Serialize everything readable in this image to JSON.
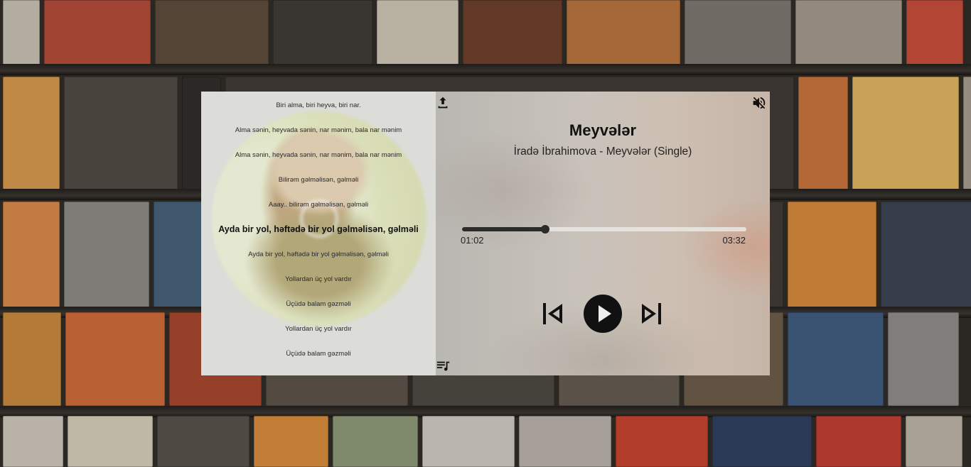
{
  "track": {
    "title": "Meyvələr",
    "subtitle": "İradə İbrahimova - Meyvələr (Single)"
  },
  "progress": {
    "current": "01:02",
    "duration": "03:32",
    "fraction": 0.292
  },
  "lyrics": [
    {
      "text": "Biri alma, biri heyva, biri nar.",
      "active": false
    },
    {
      "text": "Alma sənin, heyvada sənin, nar mənim, bala nar mənim",
      "active": false
    },
    {
      "text": "Alma sənin, heyvada sənin, nar mənim, bala nar mənim",
      "active": false
    },
    {
      "text": "Bilirəm gəlməlisən, gəlməli",
      "active": false
    },
    {
      "text": "Aaay.. bilirəm gəlməlisən, gəlməli",
      "active": false
    },
    {
      "text": "Ayda bir yol, həftədə bir yol gəlməlisən, gəlməli",
      "active": true
    },
    {
      "text": "Ayda bir yol, həftədə bir yol gəlməlisən, gəlməli",
      "active": false
    },
    {
      "text": "Yollardan üç yol vardır",
      "active": false
    },
    {
      "text": "Üçüdə balam gəzməli",
      "active": false
    },
    {
      "text": "Yollardan üç yol vardır",
      "active": false
    },
    {
      "text": "Üçüdə balam gəzməli",
      "active": false
    }
  ],
  "icons": {
    "upload": "upload-icon",
    "mute": "volume-mute-icon",
    "queue": "queue-music-icon",
    "prev": "skip-previous-icon",
    "play": "play-icon",
    "next": "skip-next-icon"
  },
  "colors": {
    "accent": "#111111",
    "progress_fill": "#2b2b2b",
    "progress_track": "#ebe8e4"
  }
}
